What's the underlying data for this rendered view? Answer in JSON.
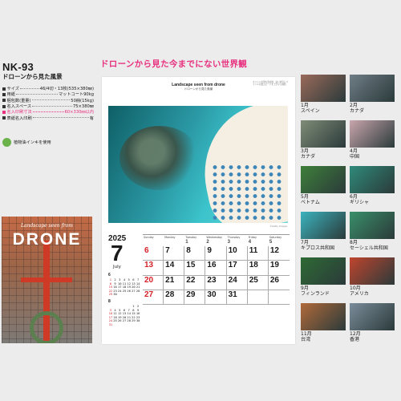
{
  "product": {
    "code": "NK-93",
    "title": "ドローンから見た風景",
    "specs": [
      {
        "label": "サイズ",
        "value": "46/4切・13枚(535×380㎜)",
        "highlight": false
      },
      {
        "label": "用紙",
        "value": "マットコート90kg",
        "highlight": false
      },
      {
        "label": "梱包数(重量)",
        "value": "50冊(15kg)",
        "highlight": false
      },
      {
        "label": "名入スペース",
        "value": "75×380㎜",
        "highlight": false
      },
      {
        "label": "名入印刷寸法",
        "value": "60×330㎜以内",
        "highlight": true
      },
      {
        "label": "表紙名入印刷",
        "value": "有",
        "highlight": false
      }
    ],
    "ink_note": "植物油インキを使用"
  },
  "cover": {
    "subtitle": "Landscape seen from",
    "title": "DRONE"
  },
  "headline": "ドローンから見た今までにない世界観",
  "calendar_page": {
    "title_en": "Landscape seen from drone",
    "title_jp": "ドローンから見た風景",
    "note": "ギリシャ北部の海岸線、白い砂浜とパラソルが並ぶビーチを上空から撮影。",
    "credit": "©Getty Images",
    "year": "2025",
    "month": "7",
    "month_name": "July",
    "weekdays": [
      "Sunday",
      "Monday",
      "Tuesday",
      "Wednesday",
      "Thursday",
      "Friday",
      "Saturday"
    ],
    "weeks": [
      [
        "",
        "",
        "1",
        "2",
        "3",
        "4",
        "5"
      ],
      [
        "6",
        "7",
        "8",
        "9",
        "10",
        "11",
        "12"
      ],
      [
        "13",
        "14",
        "15",
        "16",
        "17",
        "18",
        "19"
      ],
      [
        "20",
        "21",
        "22",
        "23",
        "24",
        "25",
        "26"
      ],
      [
        "27",
        "28",
        "29",
        "30",
        "31",
        "",
        ""
      ]
    ],
    "mini_months": [
      {
        "month": "6",
        "rows": [
          "1 2 3 4 5 6 7",
          "8 9 10 11 12 13 14",
          "15 16 17 18 19 20 21",
          "22 23 24 25 26 27 28",
          "29 30"
        ]
      },
      {
        "month": "8",
        "rows": [
          "1 2",
          "3 4 5 6 7 8 9",
          "10 11 12 13 14 15 16",
          "17 18 19 20 21 22 23",
          "24 25 26 27 28 29 30",
          "31"
        ]
      }
    ]
  },
  "thumbnails": [
    {
      "month": "1月",
      "country": "スペイン",
      "color": "#9a6a5a"
    },
    {
      "month": "2月",
      "country": "カナダ",
      "color": "#6f7d86"
    },
    {
      "month": "3月",
      "country": "カナダ",
      "color": "#7f8c78"
    },
    {
      "month": "4月",
      "country": "中国",
      "color": "#c9a6ad"
    },
    {
      "month": "5月",
      "country": "ベトナム",
      "color": "#3e7f3a"
    },
    {
      "month": "6月",
      "country": "ギリシャ",
      "color": "#2f8a7a"
    },
    {
      "month": "7月",
      "country": "キプロス共和国",
      "color": "#3bb3bd"
    },
    {
      "month": "8月",
      "country": "セーシェル共和国",
      "color": "#3a8f6a"
    },
    {
      "month": "9月",
      "country": "フィンランド",
      "color": "#2e6a34"
    },
    {
      "month": "10月",
      "country": "アメリカ",
      "color": "#c0452e"
    },
    {
      "month": "11月",
      "country": "台湾",
      "color": "#b06a3a"
    },
    {
      "month": "12月",
      "country": "香港",
      "color": "#7a8c9a"
    }
  ]
}
